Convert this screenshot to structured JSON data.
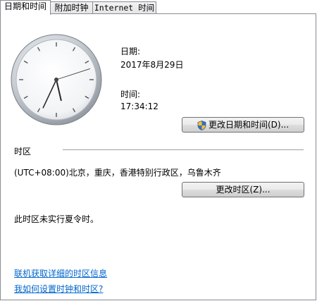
{
  "tabs": [
    {
      "label": "日期和时间",
      "active": true
    },
    {
      "label": "附加时钟",
      "active": false
    },
    {
      "label": "Internet 时间",
      "active": false
    }
  ],
  "date": {
    "label": "日期:",
    "value": "2017年8月29日"
  },
  "time": {
    "label": "时间:",
    "value": "17:34:12"
  },
  "clock": {
    "hour": 17,
    "minute": 34,
    "second": 12
  },
  "change_datetime_button": "更改日期和时间(D)...",
  "timezone": {
    "section_label": "时区",
    "value": "(UTC+08:00)北京，重庆，香港特别行政区，乌鲁木齐",
    "change_button": "更改时区(Z)...",
    "dst_note": "此时区未实行夏令时。"
  },
  "links": {
    "online_info": "联机获取详细的时区信息",
    "how_to_set": "我如何设置时钟和时区?"
  },
  "colors": {
    "link": "#0066cc",
    "border": "#898c95"
  }
}
